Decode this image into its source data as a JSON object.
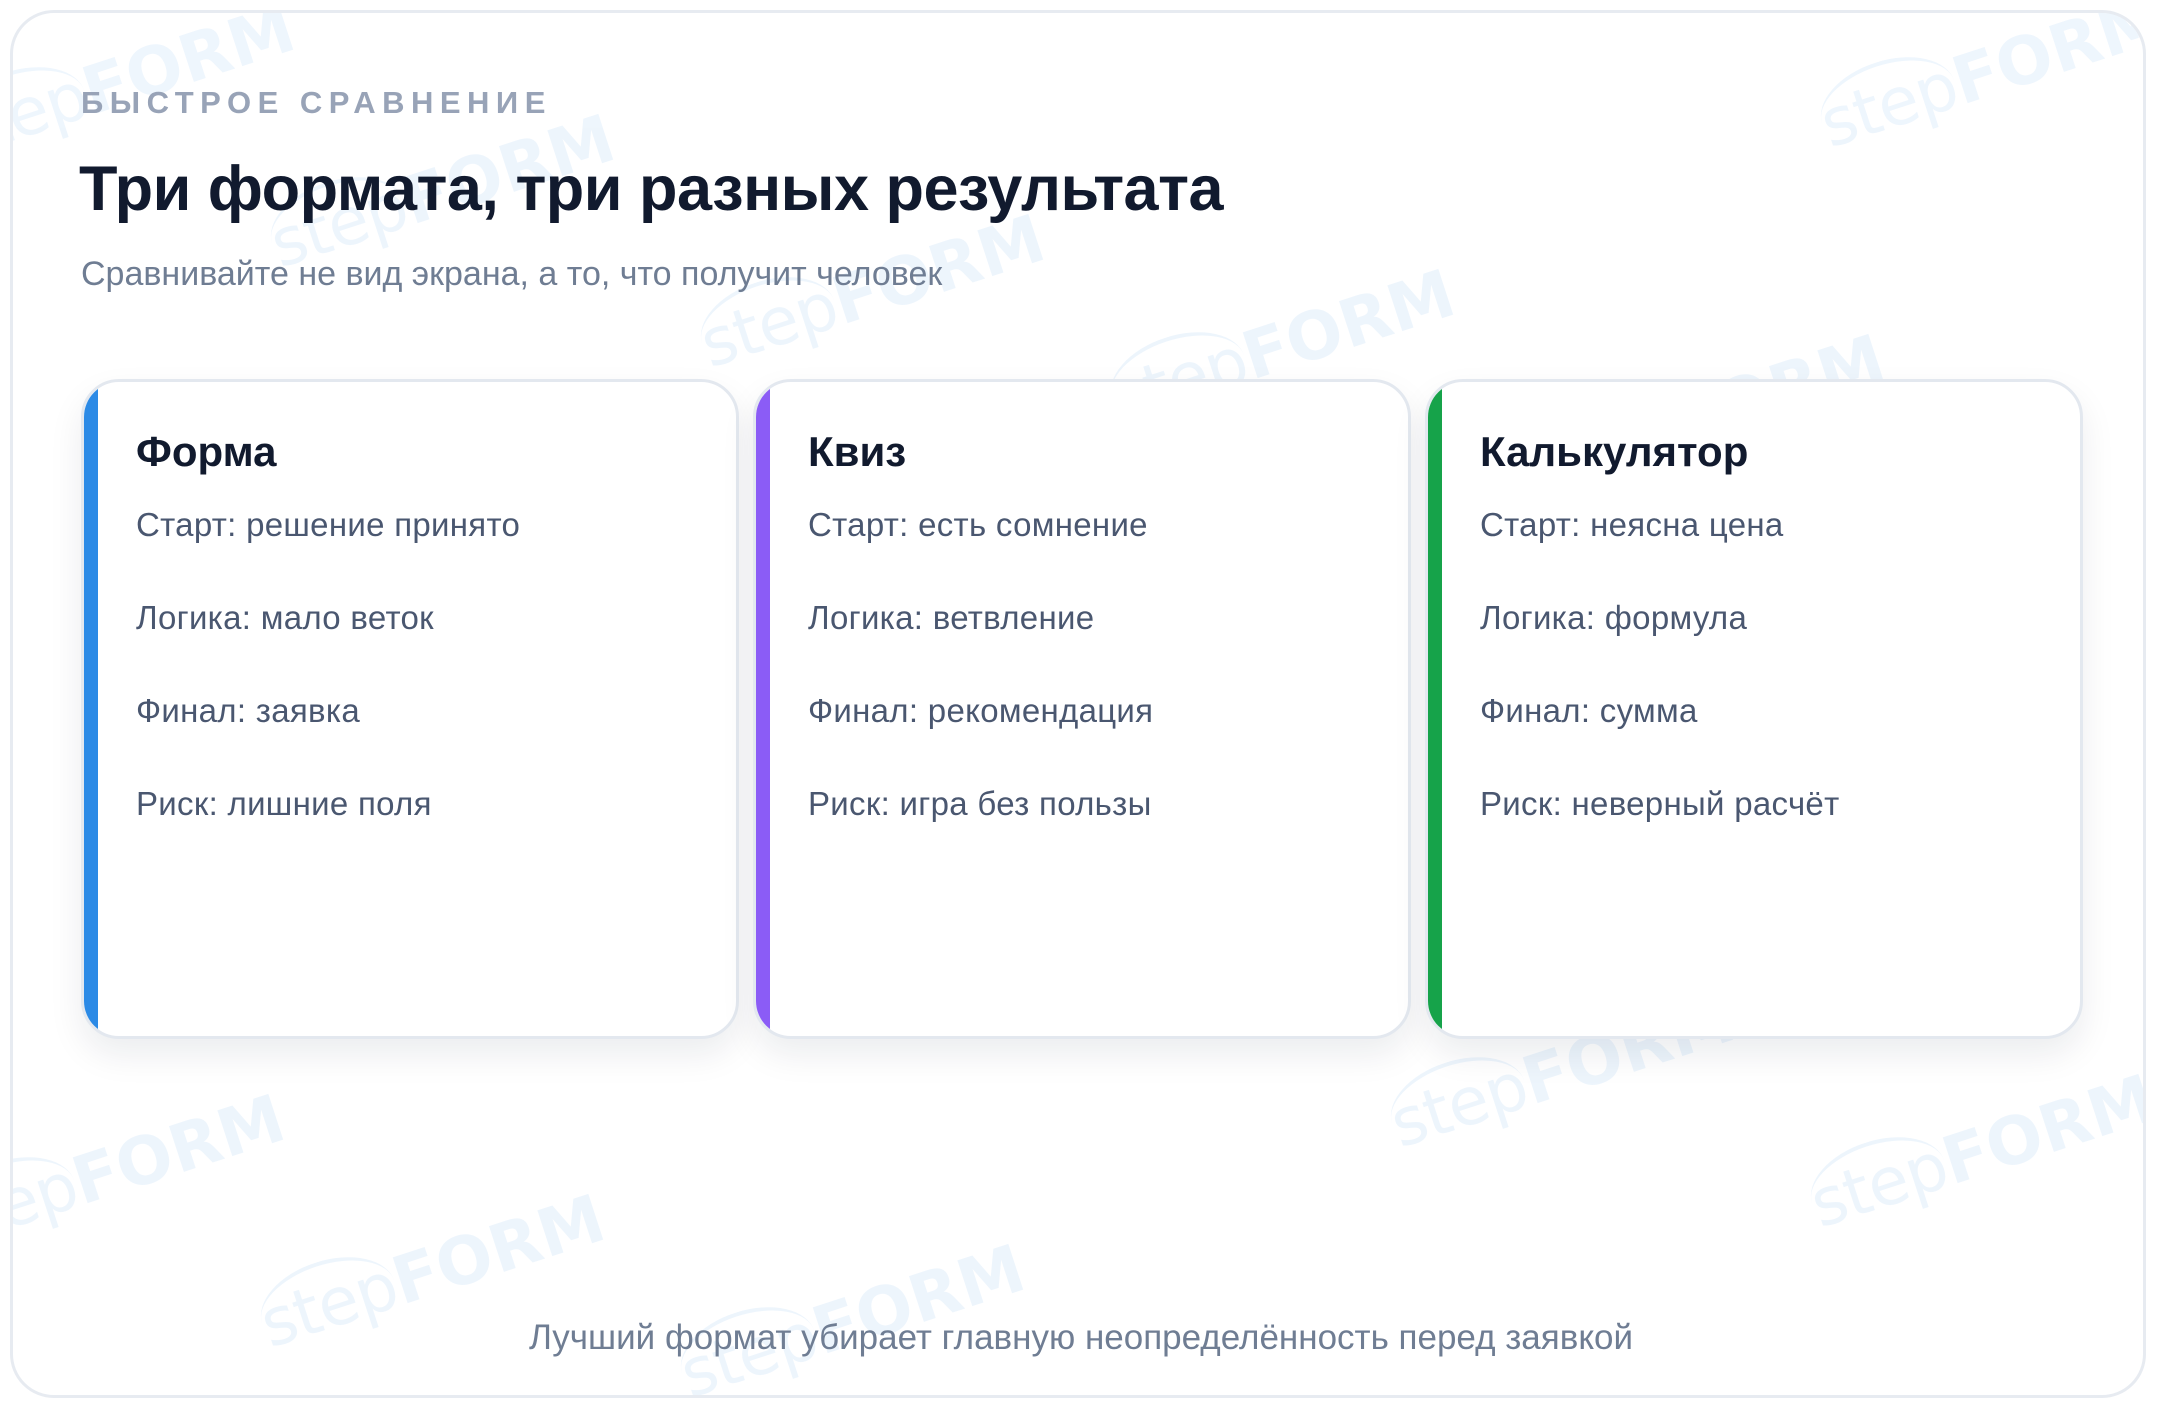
{
  "header": {
    "eyebrow": "БЫСТРОЕ СРАВНЕНИЕ",
    "title": "Три формата, три разных результата",
    "subtitle": "Сравнивайте не вид экрана, а то, что получит человек"
  },
  "cards": [
    {
      "title": "Форма",
      "accent_color": "#2b8ae6",
      "rows": [
        "Старт: решение принято",
        "Логика: мало веток",
        "Финал: заявка",
        "Риск: лишние поля"
      ]
    },
    {
      "title": "Квиз",
      "accent_color": "#8b5cf6",
      "rows": [
        "Старт: есть сомнение",
        "Логика: ветвление",
        "Финал: рекомендация",
        "Риск: игра без пользы"
      ]
    },
    {
      "title": "Калькулятор",
      "accent_color": "#16a34a",
      "rows": [
        "Старт: неясна цена",
        "Логика: формула",
        "Финал: сумма",
        "Риск: неверный расчёт"
      ]
    }
  ],
  "footer": {
    "text": "Лучший формат убирает главную неопределённость перед заявкой"
  },
  "watermark": {
    "part1": "step",
    "part2": "FORM"
  }
}
